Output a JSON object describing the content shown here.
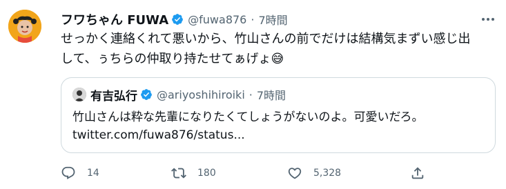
{
  "tweet": {
    "author_name": "フワちゃん FUWA",
    "author_handle": "@fuwa876",
    "dot": "·",
    "time": "7時間",
    "text_line1": "せっかく連絡くれて悪いから、竹山さんの前でだけは結構気まずい感じ出",
    "text_line2": "して、ぅちらの仲取り持たせてぁげょ😅"
  },
  "quote": {
    "author_name": "有吉弘行",
    "author_handle": "@ariyoshihiroiki",
    "dot": "·",
    "time": "7時間",
    "text": "竹山さんは粋な先輩になりたくてしょうがないのよ。可愛いだろ。",
    "link": "twitter.com/fuwa876/status..."
  },
  "actions": {
    "reply_count": "14",
    "retweet_count": "180",
    "like_count": "5,328"
  },
  "colors": {
    "verified": "#1d9bf0",
    "muted": "#536471",
    "border": "#cfd9de"
  }
}
